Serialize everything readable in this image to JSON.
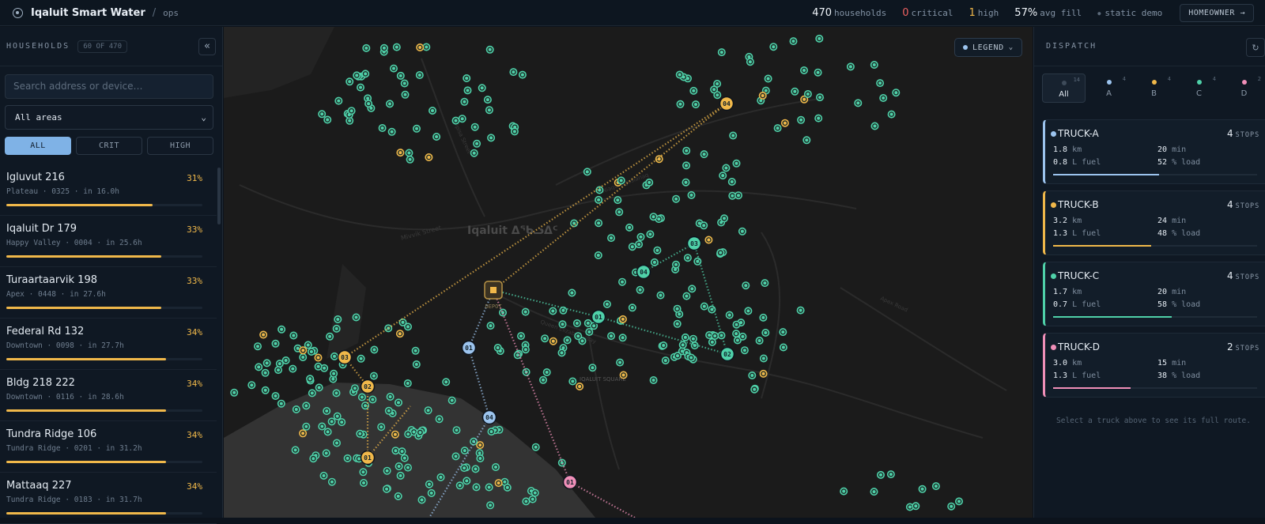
{
  "header": {
    "app_title": "Iqaluit Smart Water",
    "separator": "/",
    "section": "ops",
    "stats": [
      {
        "value": "470",
        "label": "households",
        "tone": "white"
      },
      {
        "value": "0",
        "label": "critical",
        "tone": "red"
      },
      {
        "value": "1",
        "label": "high",
        "tone": "amber"
      },
      {
        "value": "57%",
        "label": "avg fill",
        "tone": "white"
      }
    ],
    "demo_label": "static demo",
    "homeowner_button": "HOMEOWNER →"
  },
  "households": {
    "title": "HOUSEHOLDS",
    "count": "60 OF 470",
    "collapse_icon": "«",
    "search_placeholder": "Search address or device…",
    "area_select": "All areas",
    "filters": [
      "ALL",
      "CRIT",
      "HIGH"
    ],
    "active_filter": "ALL",
    "items": [
      {
        "name": "Igluvut 216",
        "meta": "Plateau · 0325 · in 16.0h",
        "pct": "31%",
        "fill": 0.31
      },
      {
        "name": "Iqaluit Dr 179",
        "meta": "Happy Valley · 0004 · in 25.6h",
        "pct": "33%",
        "fill": 0.33
      },
      {
        "name": "Turaartaarvik 198",
        "meta": "Apex · 0448 · in 27.6h",
        "pct": "33%",
        "fill": 0.33
      },
      {
        "name": "Federal Rd 132",
        "meta": "Downtown · 0098 · in 27.7h",
        "pct": "34%",
        "fill": 0.34
      },
      {
        "name": "Bldg 218 222",
        "meta": "Downtown · 0116 · in 28.6h",
        "pct": "34%",
        "fill": 0.34
      },
      {
        "name": "Tundra Ridge 106",
        "meta": "Tundra Ridge · 0201 · in 31.2h",
        "pct": "34%",
        "fill": 0.34
      },
      {
        "name": "Mattaaq 227",
        "meta": "Tundra Ridge · 0183 · in 31.7h",
        "pct": "34%",
        "fill": 0.34
      }
    ]
  },
  "map": {
    "legend_button": "LEGEND",
    "city_label": "Iqaluit ᐃᖃᓗᐃᑦ",
    "square_label": "IQALUIT SQUARE",
    "depot_label": "DEPOT",
    "street_labels": [
      "Mivvik Street",
      "Queen Elizabeth Way",
      "Niaqunngusiariaq",
      "Nipisa Street",
      "Apex Road"
    ],
    "route_stop_labels": [
      "01",
      "02",
      "03",
      "04"
    ],
    "colors": {
      "truck_a": "#9cc4ee",
      "truck_b": "#f0b84a",
      "truck_c": "#4fd1a9",
      "truck_d": "#f08fb8",
      "household": "#4fd1a9",
      "water": "#333333",
      "land": "#1b1b1b",
      "road": "#2a2a2a"
    }
  },
  "dispatch": {
    "title": "DISPATCH",
    "refresh_icon": "↻",
    "tabs": [
      {
        "label": "All",
        "count": "14",
        "color": "#3e4b5a"
      },
      {
        "label": "A",
        "count": "4",
        "color": "#9cc4ee"
      },
      {
        "label": "B",
        "count": "4",
        "color": "#f0b84a"
      },
      {
        "label": "C",
        "count": "4",
        "color": "#4fd1a9"
      },
      {
        "label": "D",
        "count": "2",
        "color": "#f08fb8"
      }
    ],
    "trucks": [
      {
        "name": "TRUCK-A",
        "stops": "4",
        "stops_label": "STOPS",
        "km": "1.8",
        "km_unit": "km",
        "min": "20",
        "min_unit": "min",
        "fuel": "0.8",
        "fuel_unit": "L fuel",
        "load": "52",
        "load_unit": "% load",
        "color": "#9cc4ee",
        "load_fraction": 0.52
      },
      {
        "name": "TRUCK-B",
        "stops": "4",
        "stops_label": "STOPS",
        "km": "3.2",
        "km_unit": "km",
        "min": "24",
        "min_unit": "min",
        "fuel": "1.3",
        "fuel_unit": "L fuel",
        "load": "48",
        "load_unit": "% load",
        "color": "#f0b84a",
        "load_fraction": 0.48
      },
      {
        "name": "TRUCK-C",
        "stops": "4",
        "stops_label": "STOPS",
        "km": "1.7",
        "km_unit": "km",
        "min": "20",
        "min_unit": "min",
        "fuel": "0.7",
        "fuel_unit": "L fuel",
        "load": "58",
        "load_unit": "% load",
        "color": "#4fd1a9",
        "load_fraction": 0.58
      },
      {
        "name": "TRUCK-D",
        "stops": "2",
        "stops_label": "STOPS",
        "km": "3.0",
        "km_unit": "km",
        "min": "15",
        "min_unit": "min",
        "fuel": "1.3",
        "fuel_unit": "L fuel",
        "load": "38",
        "load_unit": "% load",
        "color": "#f08fb8",
        "load_fraction": 0.38
      }
    ],
    "hint": "Select a truck above to see its full route."
  }
}
